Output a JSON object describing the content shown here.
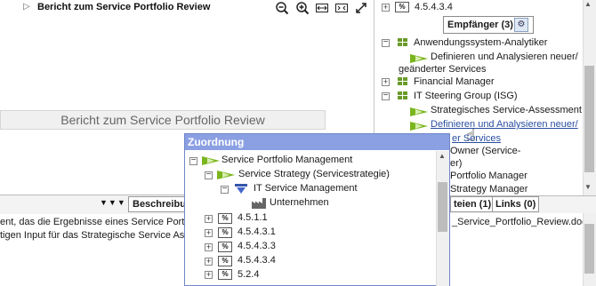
{
  "toolbar": {
    "title": "Bericht zum Service Portfolio Review",
    "icons": [
      "zoom-out-icon",
      "zoom-in-icon",
      "fit-width-icon",
      "fit-page-icon",
      "fullscreen-icon"
    ]
  },
  "main": {
    "report_bar_text": "Bericht zum Service Portfolio Review",
    "desc_tab_label": "Beschreibu",
    "desc_lines": [
      "ent, das die Ergebnisse eines Service Port",
      "tigen Input für das Strategische Service As"
    ]
  },
  "right_pane": {
    "top_item": "4.5.4.3.4",
    "recipients_label": "Empfänger (3)",
    "tree": [
      {
        "label": "Anwendungssystem-Analytiker",
        "type": "role"
      },
      {
        "label": "Definieren und Analysieren neuer/",
        "type": "process"
      },
      {
        "label": "geänderter Services",
        "type": "cont"
      },
      {
        "label": "Financial Manager",
        "type": "role"
      },
      {
        "label": "IT Steering Group (ISG)",
        "type": "role"
      },
      {
        "label": "Strategisches Service-Assessment",
        "type": "process"
      },
      {
        "label": "Definieren und Analysieren neuer/",
        "type": "process-link"
      },
      {
        "label": "er Services",
        "type": "cont-link"
      },
      {
        "label": "Owner (Service-",
        "type": "partial"
      },
      {
        "label": "er)",
        "type": "partial"
      },
      {
        "label": "Portfolio Manager",
        "type": "partial"
      },
      {
        "label": "Strategy Manager",
        "type": "partial"
      }
    ],
    "tabs": [
      "teien (1)",
      "Links (0)"
    ],
    "document": "_Service_Portfolio_Review.doc"
  },
  "popup": {
    "title": "Zuordnung",
    "items": [
      {
        "label": "Service Portfolio Management"
      },
      {
        "label": "Service Strategy (Servicestrategie)"
      },
      {
        "label": "IT Service Management"
      },
      {
        "label": "Unternehmen"
      },
      {
        "label": "4.5.1.1"
      },
      {
        "label": "4.5.4.3.1"
      },
      {
        "label": "4.5.4.3.3"
      },
      {
        "label": "4.5.4.3.4"
      },
      {
        "label": "5.2.4"
      }
    ]
  }
}
